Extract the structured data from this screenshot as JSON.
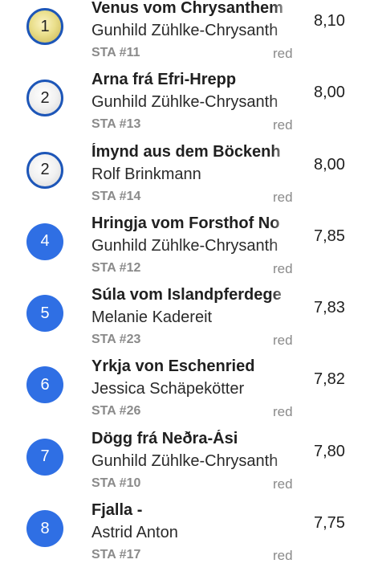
{
  "results": [
    {
      "rank": "1",
      "style": "gold",
      "horse": "Venus vom Chrysanthem",
      "rider": "Gunhild Zühlke-Chrysanth",
      "sta": "STA #11",
      "tag": "red",
      "score": "8,10"
    },
    {
      "rank": "2",
      "style": "silver",
      "horse": "Arna frá Efri-Hrepp",
      "rider": "Gunhild Zühlke-Chrysanth",
      "sta": "STA #13",
      "tag": "red",
      "score": "8,00"
    },
    {
      "rank": "2",
      "style": "silver",
      "horse": "Ímynd aus dem Böckenh",
      "rider": "Rolf Brinkmann",
      "sta": "STA #14",
      "tag": "red",
      "score": "8,00"
    },
    {
      "rank": "4",
      "style": "blue",
      "horse": "Hringja vom Forsthof No",
      "rider": "Gunhild Zühlke-Chrysanth",
      "sta": "STA #12",
      "tag": "red",
      "score": "7,85"
    },
    {
      "rank": "5",
      "style": "blue",
      "horse": "Súla vom Islandpferdege",
      "rider": "Melanie Kadereit",
      "sta": "STA #23",
      "tag": "red",
      "score": "7,83"
    },
    {
      "rank": "6",
      "style": "blue",
      "horse": "Yrkja von Eschenried",
      "rider": "Jessica Schäpekötter",
      "sta": "STA #26",
      "tag": "red",
      "score": "7,82"
    },
    {
      "rank": "7",
      "style": "blue",
      "horse": "Dögg frá Neðra-Ási",
      "rider": "Gunhild Zühlke-Chrysanth",
      "sta": "STA #10",
      "tag": "red",
      "score": "7,80"
    },
    {
      "rank": "8",
      "style": "blue",
      "horse": "Fjalla -",
      "rider": "Astrid Anton",
      "sta": "STA #17",
      "tag": "red",
      "score": "7,75"
    }
  ],
  "colors": {
    "rank_blue": "#2f6fe4",
    "medal_border": "#1d56b8",
    "muted_text": "#8a8a8a"
  }
}
